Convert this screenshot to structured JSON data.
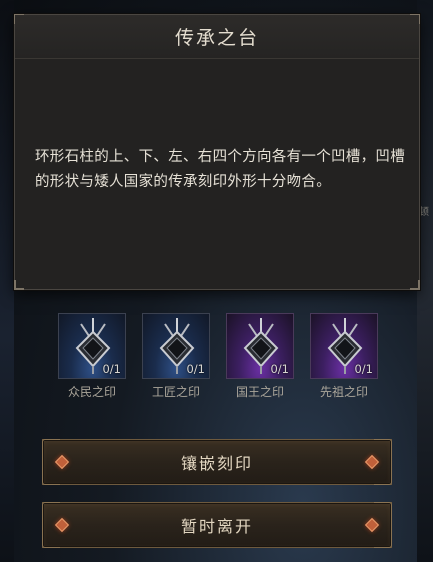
{
  "dialog": {
    "title": "传承之台",
    "description": "环形石柱的上、下、左、右四个方向各有一个凹槽，凹槽的形状与矮人国家的传承刻印外形十分吻合。"
  },
  "seals": [
    {
      "name": "众民之印",
      "count": "0/1",
      "color": "blue",
      "icon": "seal-crystal-icon"
    },
    {
      "name": "工匠之印",
      "count": "0/1",
      "color": "blue",
      "icon": "seal-crystal-icon"
    },
    {
      "name": "国王之印",
      "count": "0/1",
      "color": "purple",
      "icon": "seal-crystal-icon"
    },
    {
      "name": "先祖之印",
      "count": "0/1",
      "color": "purple",
      "icon": "seal-crystal-icon"
    }
  ],
  "actions": {
    "inlay_label": "镶嵌刻印",
    "leave_label": "暂时离开"
  },
  "background": {
    "side_text": "顿"
  },
  "colors": {
    "panel_bg": "#232221",
    "accent_gem": "#c0603a",
    "rarity_blue": "#2e4f86",
    "rarity_purple": "#6a2fa3"
  }
}
